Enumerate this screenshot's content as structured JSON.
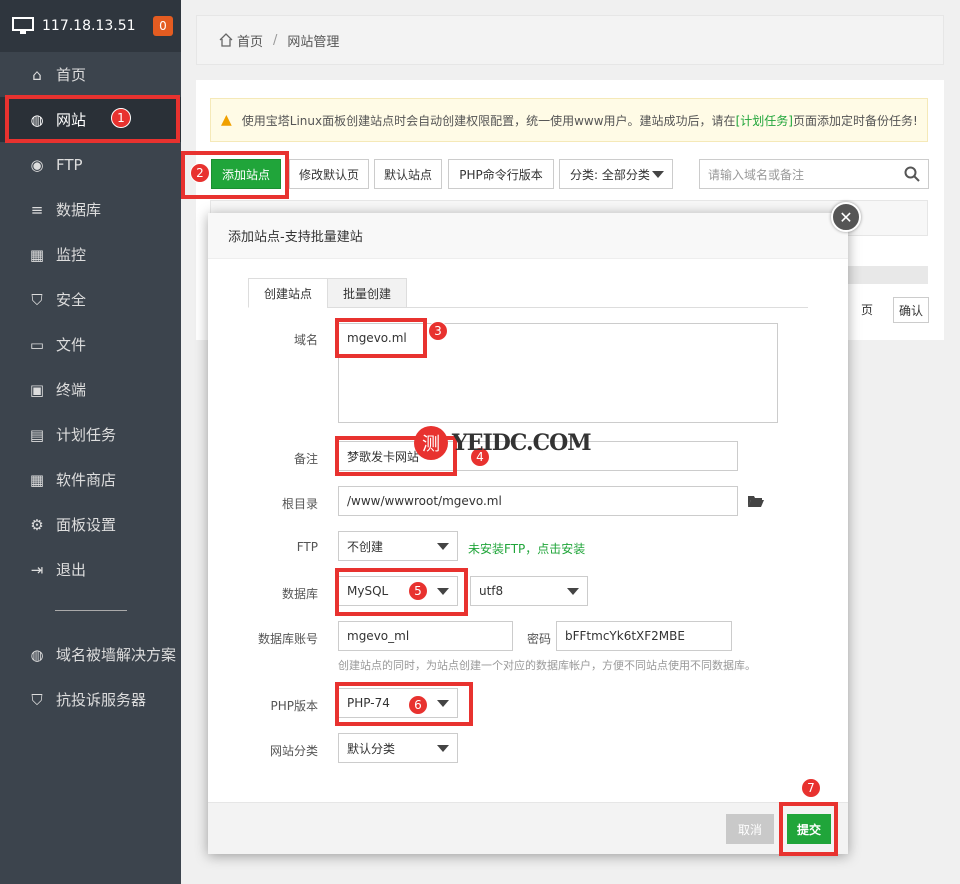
{
  "server": {
    "ip": "117.18.13.51",
    "badge": "0"
  },
  "sidebar": {
    "items": [
      {
        "label": "首页",
        "icon": "home-icon"
      },
      {
        "label": "网站",
        "icon": "globe-icon"
      },
      {
        "label": "FTP",
        "icon": "ftp-icon"
      },
      {
        "label": "数据库",
        "icon": "database-icon"
      },
      {
        "label": "监控",
        "icon": "monitor-icon"
      },
      {
        "label": "安全",
        "icon": "shield-icon"
      },
      {
        "label": "文件",
        "icon": "folder-icon"
      },
      {
        "label": "终端",
        "icon": "terminal-icon"
      },
      {
        "label": "计划任务",
        "icon": "calendar-icon"
      },
      {
        "label": "软件商店",
        "icon": "apps-icon"
      },
      {
        "label": "面板设置",
        "icon": "gear-icon"
      },
      {
        "label": "退出",
        "icon": "logout-icon"
      },
      {
        "label": "域名被墙解决方案",
        "icon": "globe-lock-icon"
      },
      {
        "label": "抗投诉服务器",
        "icon": "shield-check-icon"
      }
    ],
    "divider": "————"
  },
  "breadcrumb": {
    "home": "首页",
    "sep": "/",
    "current": "网站管理"
  },
  "notice": {
    "text_before": "使用宝塔Linux面板创建站点时会自动创建权限配置，统一使用www用户。建站成功后，请在",
    "link": "[计划任务]",
    "text_after": "页面添加定时备份任务!"
  },
  "toolbar": {
    "add_site": "添加站点",
    "edit_default": "修改默认页",
    "default_site": "默认站点",
    "php_cli": "PHP命令行版本",
    "category": "分类: 全部分类",
    "search_placeholder": "请输入域名或备注"
  },
  "pager": {
    "page": "页",
    "confirm": "确认"
  },
  "dialog": {
    "title": "添加站点-支持批量建站",
    "tabs": [
      "创建站点",
      "批量创建"
    ],
    "labels": {
      "domain": "域名",
      "remark": "备注",
      "root": "根目录",
      "ftp": "FTP",
      "database": "数据库",
      "db_account": "数据库账号",
      "password": "密码",
      "php": "PHP版本",
      "category": "网站分类"
    },
    "values": {
      "domain": "mgevo.ml",
      "remark": "梦歌发卡网站",
      "root": "/www/wwwroot/mgevo.ml",
      "ftp": "不创建",
      "ftp_hint": "未安装FTP，点击安装",
      "db_type": "MySQL",
      "charset": "utf8",
      "db_user": "mgevo_ml",
      "db_pass": "bFFtmcYk6tXF2MBE",
      "db_hint": "创建站点的同时，为站点创建一个对应的数据库帐户，方便不同站点使用不同数据库。",
      "php": "PHP-74",
      "category": "默认分类"
    },
    "cancel": "取消",
    "submit": "提交"
  },
  "annotations": [
    "1",
    "2",
    "3",
    "4",
    "5",
    "6",
    "7"
  ],
  "watermark": {
    "glyph": "测",
    "text": "YEIDC.COM"
  },
  "colors": {
    "accent": "#20a53a",
    "annotation": "#e8322f",
    "sidebar": "#3c444d"
  }
}
